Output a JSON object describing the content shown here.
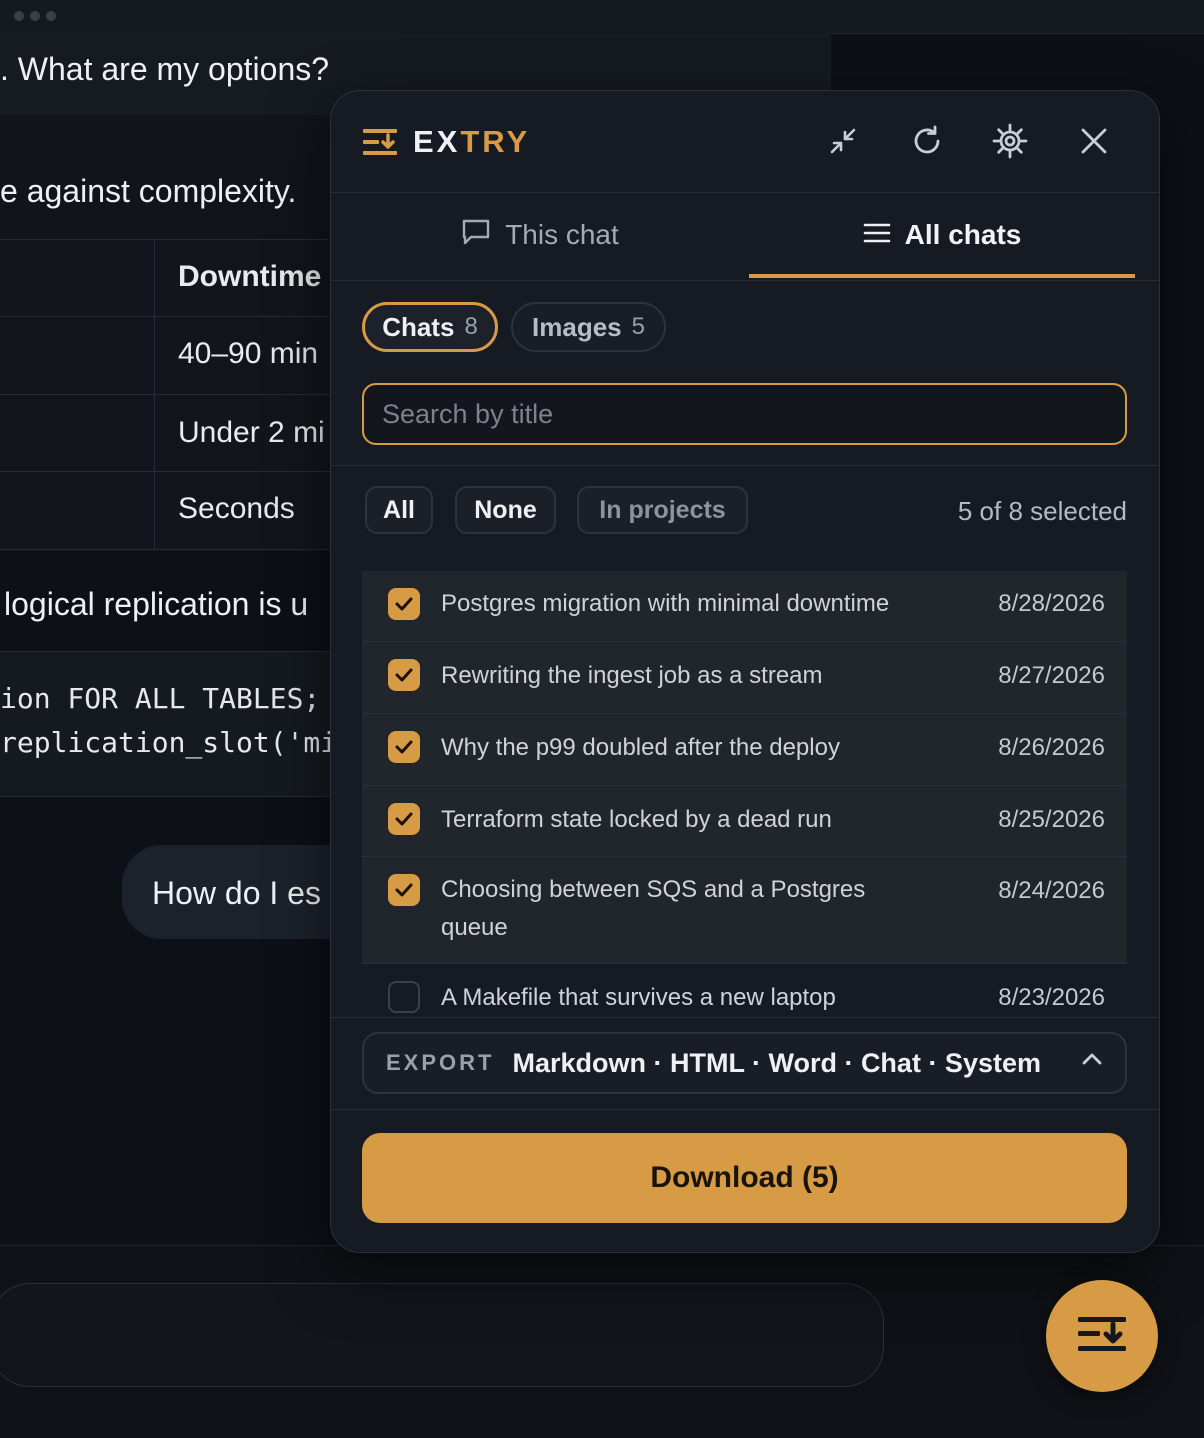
{
  "background": {
    "lines": [
      ". What are my options?",
      "e against complexity.",
      "logical replication is u",
      "How do I es"
    ],
    "table": {
      "header": "Downtime",
      "cells": [
        "40–90 min",
        "Under 2 mi",
        "Seconds"
      ]
    },
    "code": [
      "ion FOR ALL TABLES;",
      "replication_slot('mi"
    ]
  },
  "panel": {
    "brand_ex": "EX",
    "brand_try": "TRY",
    "tabs": {
      "this_chat": "This chat",
      "all_chats": "All chats"
    },
    "pills": [
      {
        "label": "Chats",
        "count": "8"
      },
      {
        "label": "Images",
        "count": "5"
      }
    ],
    "search": {
      "placeholder": "Search by title"
    },
    "filters": {
      "all": "All",
      "none": "None",
      "in_projects": "In projects"
    },
    "selected_text": "5 of 8 selected",
    "chats": [
      {
        "title": "Postgres migration with minimal downtime",
        "date": "8/28/2026",
        "checked": true
      },
      {
        "title": "Rewriting the ingest job as a stream",
        "date": "8/27/2026",
        "checked": true
      },
      {
        "title": "Why the p99 doubled after the deploy",
        "date": "8/26/2026",
        "checked": true
      },
      {
        "title": "Terraform state locked by a dead run",
        "date": "8/25/2026",
        "checked": true
      },
      {
        "title": "Choosing between SQS and a Postgres queue",
        "date": "8/24/2026",
        "checked": true
      },
      {
        "title": "A Makefile that survives a new laptop",
        "date": "8/23/2026",
        "checked": false
      }
    ],
    "export": {
      "label": "EXPORT",
      "formats": "Markdown · HTML · Word · Chat · System"
    },
    "download_label": "Download (5)"
  },
  "colors": {
    "accent": "#d79b46",
    "panel_bg": "#161a22",
    "page_bg": "#0d1016"
  },
  "icons": [
    "extry-logo-icon",
    "minimize-icon",
    "refresh-icon",
    "gear-icon",
    "close-icon",
    "chat-bubble-icon",
    "list-icon",
    "checkmark-icon",
    "chevron-up-icon"
  ]
}
